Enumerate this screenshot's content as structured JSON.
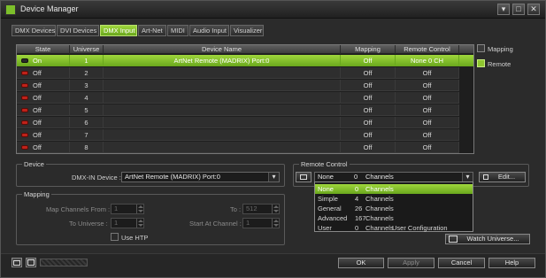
{
  "window": {
    "title": "Device Manager",
    "controls": [
      "▾",
      "□",
      "✕"
    ]
  },
  "tabs": [
    {
      "label": "DMX Devices",
      "active": false
    },
    {
      "label": "DVI Devices",
      "active": false
    },
    {
      "label": "DMX Input",
      "active": true
    },
    {
      "label": "Art-Net",
      "active": false
    },
    {
      "label": "MIDI",
      "active": false
    },
    {
      "label": "Audio Input",
      "active": false
    },
    {
      "label": "Visualizer",
      "active": false
    }
  ],
  "grid": {
    "columns": [
      "State",
      "Universe",
      "Device Name",
      "Mapping",
      "Remote Control"
    ],
    "rows": [
      {
        "state": "On",
        "universe": "1",
        "device": "ArtNet Remote (MADRIX) Port:0",
        "mapping": "Off",
        "remote": "None  0 CH",
        "selected": true
      },
      {
        "state": "Off",
        "universe": "2",
        "device": "",
        "mapping": "Off",
        "remote": "Off",
        "selected": false
      },
      {
        "state": "Off",
        "universe": "3",
        "device": "",
        "mapping": "Off",
        "remote": "Off",
        "selected": false
      },
      {
        "state": "Off",
        "universe": "4",
        "device": "",
        "mapping": "Off",
        "remote": "Off",
        "selected": false
      },
      {
        "state": "Off",
        "universe": "5",
        "device": "",
        "mapping": "Off",
        "remote": "Off",
        "selected": false
      },
      {
        "state": "Off",
        "universe": "6",
        "device": "",
        "mapping": "Off",
        "remote": "Off",
        "selected": false
      },
      {
        "state": "Off",
        "universe": "7",
        "device": "",
        "mapping": "Off",
        "remote": "Off",
        "selected": false
      },
      {
        "state": "Off",
        "universe": "8",
        "device": "",
        "mapping": "Off",
        "remote": "Off",
        "selected": false
      }
    ]
  },
  "side": {
    "mapping_label": "Mapping",
    "remote_label": "Remote"
  },
  "device_group": {
    "title": "Device",
    "dmx_in_label": "DMX-IN Device :",
    "dmx_in_value": "ArtNet Remote (MADRIX) Port:0"
  },
  "mapping_group": {
    "title": "Mapping",
    "from_label": "Map Channels From :",
    "from_value": "1",
    "to_label": "To :",
    "to_value": "512",
    "to_universe_label": "To Universe :",
    "to_universe_value": "1",
    "start_channel_label": "Start At Channel :",
    "start_channel_value": "1",
    "use_htp_label": "Use HTP"
  },
  "remote_group": {
    "title": "Remote Control",
    "selected": {
      "name": "None",
      "count": "0",
      "unit": "Channels"
    },
    "edit_label": "Edit...",
    "options": [
      {
        "name": "None",
        "count": "0",
        "unit": "Channels",
        "note": "",
        "selected": true
      },
      {
        "name": "Simple",
        "count": "4",
        "unit": "Channels",
        "note": "",
        "selected": false
      },
      {
        "name": "General",
        "count": "26",
        "unit": "Channels",
        "note": "",
        "selected": false
      },
      {
        "name": "Advanced",
        "count": "167",
        "unit": "Channels",
        "note": "",
        "selected": false
      },
      {
        "name": "User",
        "count": "0",
        "unit": "Channels",
        "note": "User Configuration",
        "selected": false
      }
    ]
  },
  "watch_universe_label": "Watch Universe...",
  "footer": {
    "ok_label": "OK",
    "apply_label": "Apply",
    "cancel_label": "Cancel",
    "help_label": "Help"
  }
}
